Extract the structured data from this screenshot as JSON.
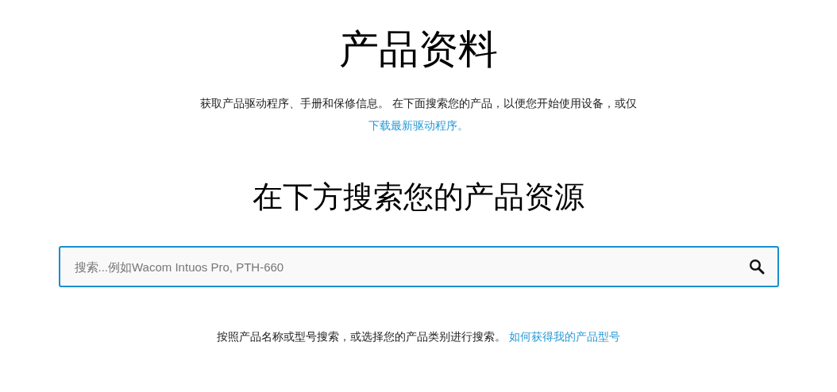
{
  "title": "产品资料",
  "intro": {
    "text": "获取产品驱动程序、手册和保修信息。 在下面搜索您的产品，以便您开始使用设备，或仅",
    "link": "下载最新驱动程序。"
  },
  "search_heading": "在下方搜索您的产品资源",
  "search": {
    "placeholder": "搜索...例如Wacom Intuos Pro, PTH-660"
  },
  "hint": {
    "text": "按照产品名称或型号搜索，或选择您的产品类别进行搜索。",
    "link": "如何获得我的产品型号"
  }
}
